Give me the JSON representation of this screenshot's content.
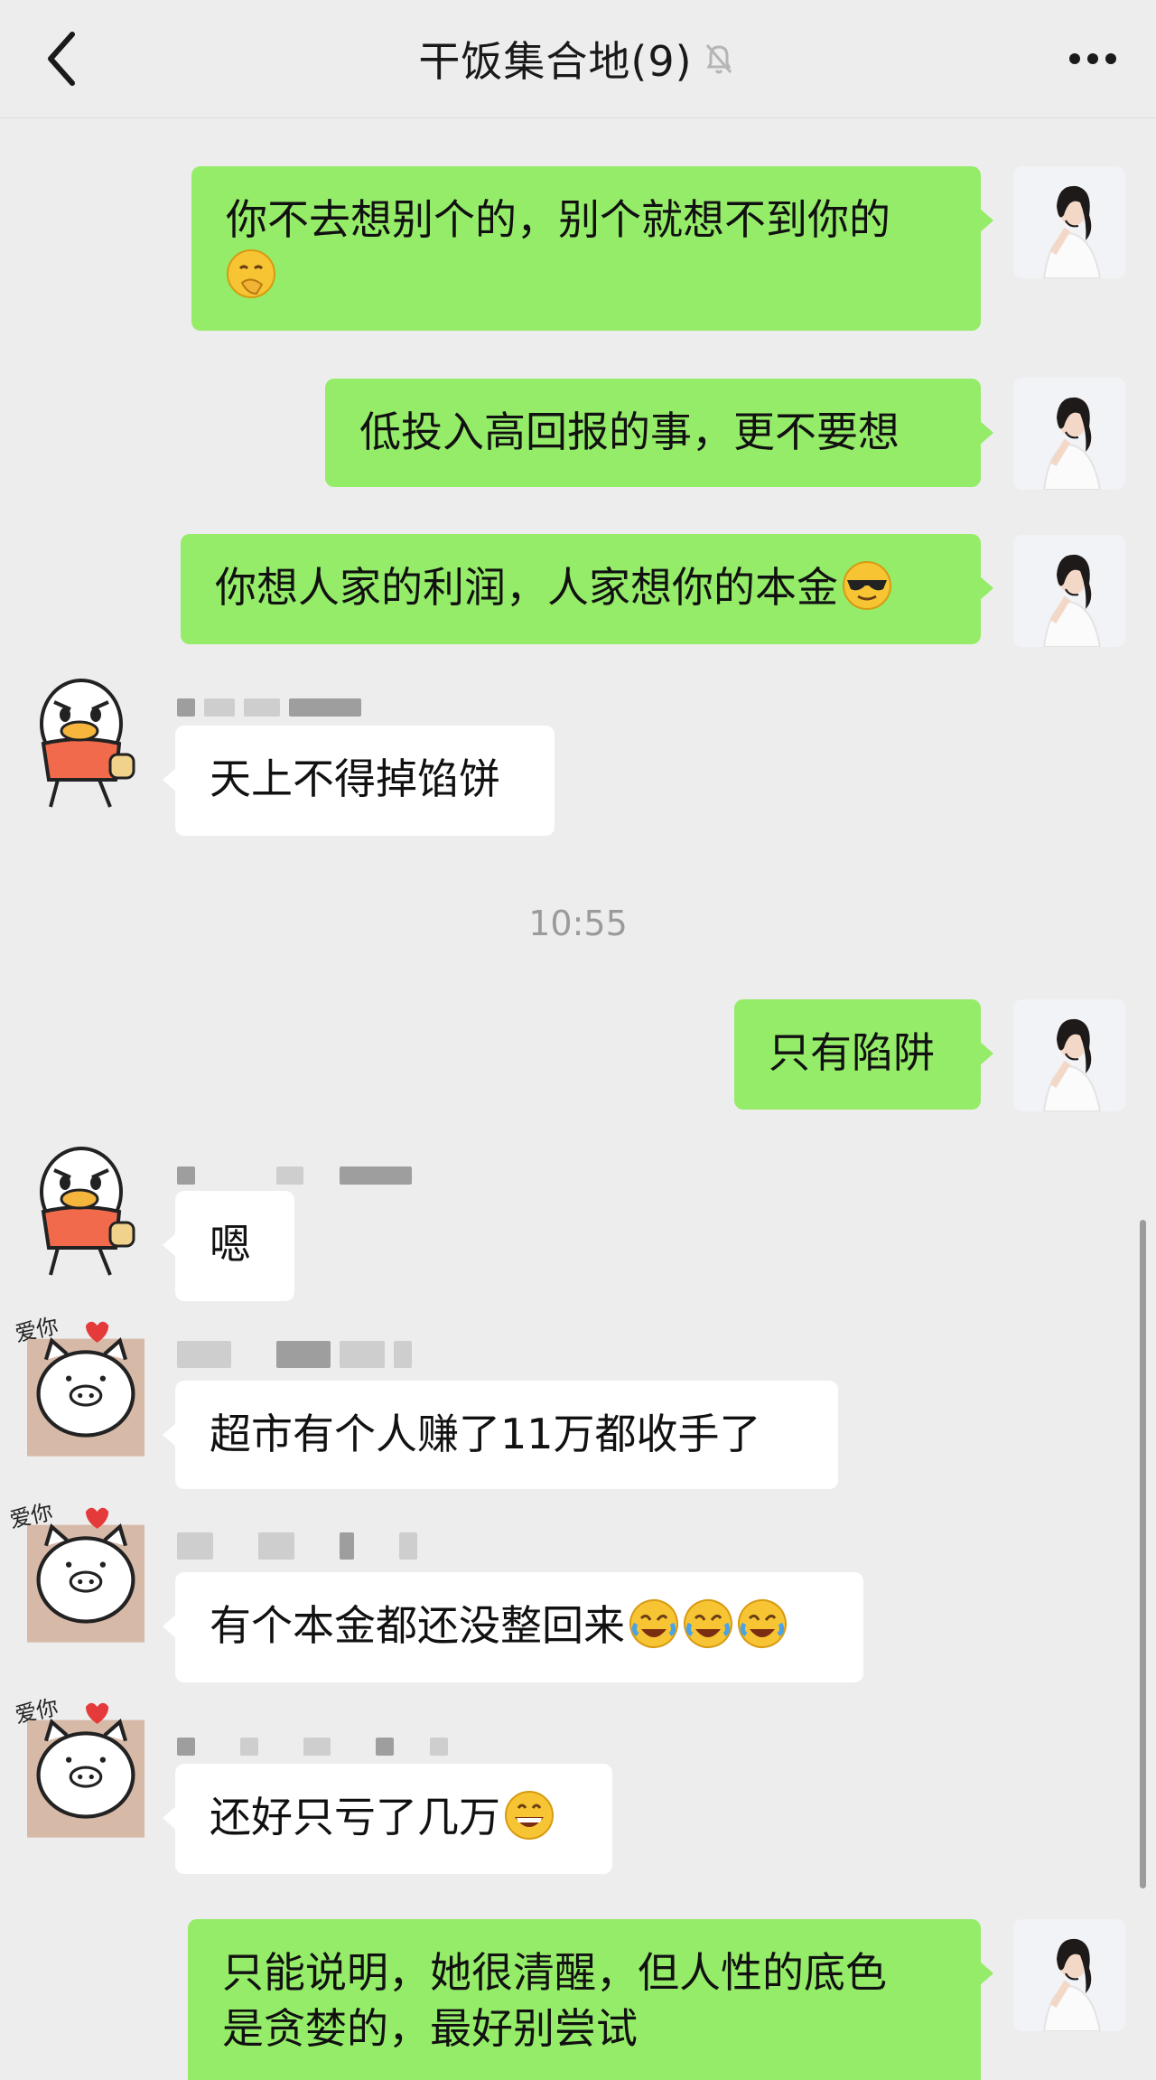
{
  "header": {
    "title": "干饭集合地(9)",
    "back_icon": "chevron-left-icon",
    "mute_icon": "bell-off-icon",
    "more_icon": "more-dots-icon"
  },
  "timestamp": "10:55",
  "messages": [
    {
      "side": "right",
      "text": "你不去想别个的，别个就想不到你的",
      "emoji": [
        "face-hand-over-mouth"
      ]
    },
    {
      "side": "right",
      "text": "低投入高回报的事，更不要想",
      "emoji": []
    },
    {
      "side": "right",
      "text": "你想人家的利润，人家想你的本金",
      "emoji": [
        "smiling-face-with-sunglasses"
      ]
    },
    {
      "side": "left",
      "avatar": "duck-avatar",
      "text": "天上不得掉馅饼",
      "emoji": []
    },
    {
      "side": "right",
      "text": "只有陷阱",
      "emoji": []
    },
    {
      "side": "left",
      "avatar": "duck-avatar",
      "text": "嗯",
      "emoji": []
    },
    {
      "side": "left",
      "avatar": "pig-avatar",
      "avatar_label": "爱你",
      "text": "超市有个人赚了11万都收手了",
      "emoji": []
    },
    {
      "side": "left",
      "avatar": "pig-avatar",
      "avatar_label": "爱你",
      "text": "有个本金都还没整回来",
      "emoji": [
        "rolling-laughing",
        "rolling-laughing",
        "rolling-laughing"
      ]
    },
    {
      "side": "left",
      "avatar": "pig-avatar",
      "avatar_label": "爱你",
      "text": "还好只亏了几万",
      "emoji": [
        "grinning-face"
      ]
    },
    {
      "side": "right",
      "text_line1": "只能说明，她很清醒，但人性的底色",
      "text_line2": "是贪婪的，最好别尝试",
      "emoji": []
    }
  ],
  "colors": {
    "outgoing_bubble": "#95ec69",
    "incoming_bubble": "#ffffff",
    "background": "#ededed"
  }
}
